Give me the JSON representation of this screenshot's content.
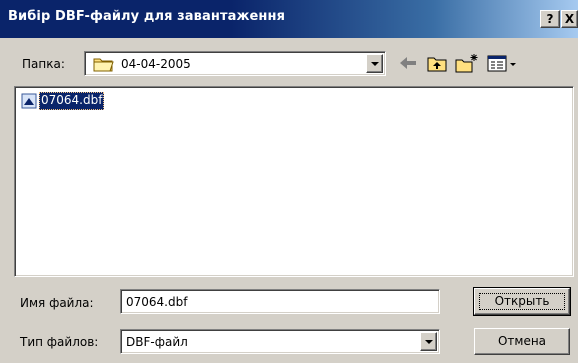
{
  "window": {
    "title": "Вибір DBF-файлу для завантаження",
    "help_button": "?",
    "close_button": "X"
  },
  "folder": {
    "label": "Папка:",
    "current": "04-04-2005"
  },
  "toolbar": {
    "icons": [
      "back-arrow-icon",
      "up-folder-icon",
      "new-folder-icon",
      "view-menu-icon"
    ]
  },
  "files": [
    {
      "name": "07064.dbf",
      "selected": true
    }
  ],
  "filename": {
    "label": "Имя файла:",
    "value": "07064.dbf"
  },
  "filetype": {
    "label": "Тип файлов:",
    "value": "DBF-файл"
  },
  "buttons": {
    "open": "Открыть",
    "cancel": "Отмена"
  },
  "colors": {
    "title_bar": "#0a246a",
    "face": "#d4d0c8",
    "selection": "#0a246a"
  }
}
